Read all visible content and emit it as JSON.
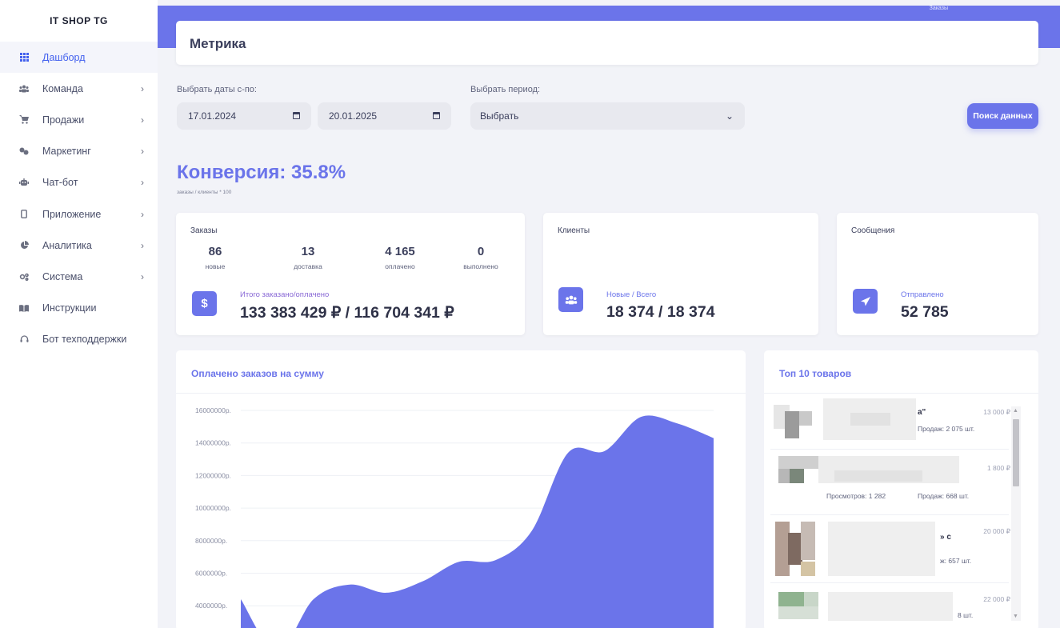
{
  "brand": "IT SHOP TG",
  "sidebar": {
    "items": [
      {
        "label": "Дашборд",
        "icon": "grid-icon",
        "active": true
      },
      {
        "label": "Команда",
        "icon": "users-icon",
        "chevron": true
      },
      {
        "label": "Продажи",
        "icon": "cart-icon",
        "chevron": true
      },
      {
        "label": "Маркетинг",
        "icon": "megaphone-icon",
        "chevron": true
      },
      {
        "label": "Чат-бот",
        "icon": "robot-icon",
        "chevron": true
      },
      {
        "label": "Приложение",
        "icon": "mobile-icon",
        "chevron": true
      },
      {
        "label": "Аналитика",
        "icon": "pie-chart-icon",
        "chevron": true
      },
      {
        "label": "Система",
        "icon": "cogs-icon",
        "chevron": true
      },
      {
        "label": "Инструкции",
        "icon": "book-icon"
      },
      {
        "label": "Бот техподдержки",
        "icon": "headset-icon"
      }
    ]
  },
  "banner": {
    "right_label": "Заказы"
  },
  "page_title": "Метрика",
  "filters": {
    "date_label": "Выбрать даты с-по:",
    "date_from": "17.01.2024",
    "date_to": "20.01.2025",
    "period_label": "Выбрать период:",
    "period_value": "Выбрать",
    "search_button": "Поиск данных"
  },
  "conversion": {
    "title": "Конверсия: 35.8%",
    "formula": "заказы / клиенты * 100"
  },
  "orders_card": {
    "title": "Заказы",
    "stats": [
      {
        "value": "86",
        "label": "новые"
      },
      {
        "value": "13",
        "label": "доставка"
      },
      {
        "value": "4 165",
        "label": "оплачено"
      },
      {
        "value": "0",
        "label": "выполнено"
      }
    ],
    "icon_glyph": "$",
    "total_label": "Итого заказано/оплачено",
    "total_value": "133 383 429 ₽ / 116 704 341 ₽"
  },
  "clients_card": {
    "title": "Клиенты",
    "label": "Новые / Всего",
    "value": "18 374 / 18 374"
  },
  "messages_card": {
    "title": "Сообщения",
    "label": "Отправлено",
    "value": "52 785"
  },
  "chart_data": {
    "type": "area",
    "title": "Оплачено заказов на сумму",
    "ylim": [
      0,
      16000000
    ],
    "y_ticks": [
      "16000000р.",
      "14000000р.",
      "12000000р.",
      "10000000р.",
      "8000000р.",
      "6000000р.",
      "4000000р."
    ],
    "series": [
      {
        "values": [
          4400000,
          1200000,
          4400000,
          5300000,
          4800000,
          5500000,
          6700000,
          6800000,
          8600000,
          13400000,
          13500000,
          15600000,
          15200000,
          14300000
        ],
        "color": "#6b74ea"
      }
    ]
  },
  "top_products": {
    "title": "Топ 10 товаров",
    "items": [
      {
        "name_tail": "а\"",
        "price": "13 000 ₽",
        "sales": "Продаж: 2 075 шт."
      },
      {
        "price": "1 800 ₽",
        "views": "Просмотров: 1 282",
        "sales": "Продаж: 668 шт."
      },
      {
        "name_tail": "» с",
        "price": "20 000 ₽",
        "sales": "ж: 657 шт."
      },
      {
        "price": "22 000 ₽",
        "sales": "8 шт."
      }
    ]
  },
  "colors": {
    "accent": "#6b74ea",
    "background": "#f2f3f8"
  }
}
